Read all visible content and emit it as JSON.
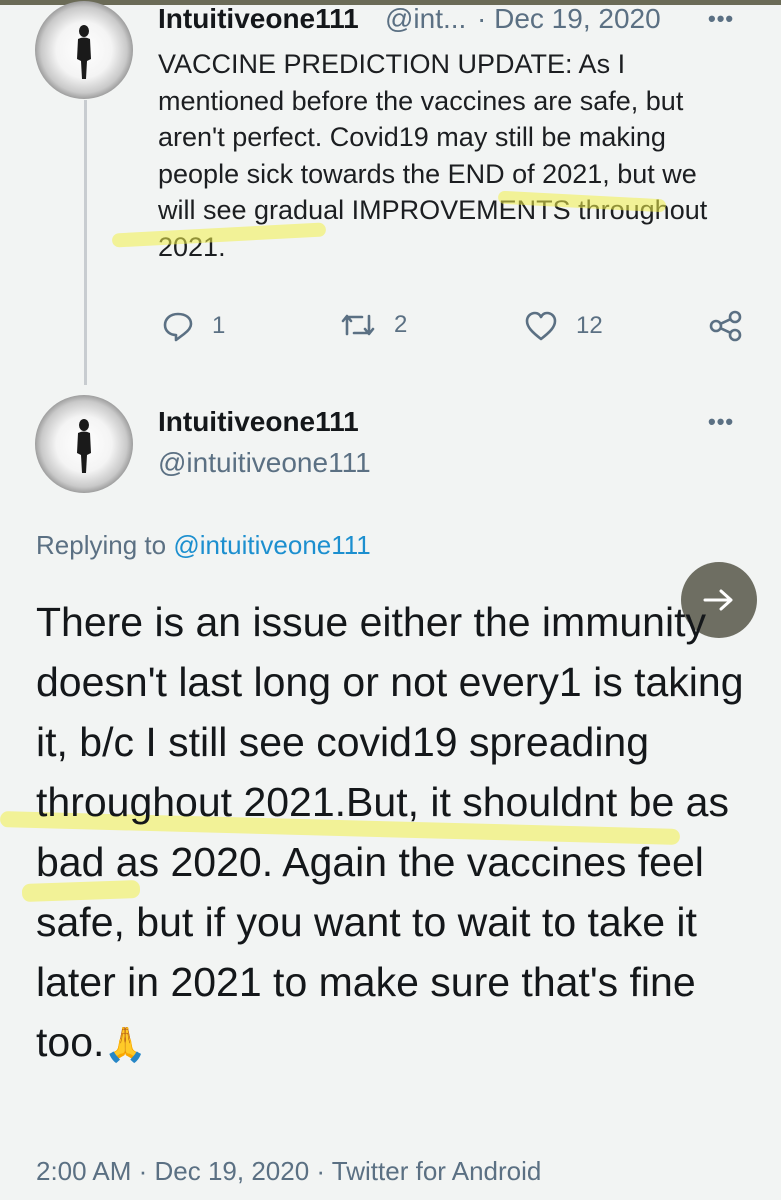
{
  "tweet1": {
    "display_name": "Intuitiveone111",
    "handle_truncated": "@int...",
    "separator_date": "· Dec 19, 2020",
    "more_label": "•••",
    "text": "VACCINE PREDICTION UPDATE: As I mentioned before the vaccines are safe, but aren't perfect. Covid19 may still be making people sick towards the END of 2021, but we will see gradual IMPROVEMENTS throughout 2021.",
    "replies": "1",
    "retweets": "2",
    "likes": "12"
  },
  "tweet2": {
    "display_name": "Intuitiveone111",
    "handle": "@intuitiveone111",
    "more_label": "•••",
    "replying_prefix": "Replying to ",
    "replying_handle": "@intuitiveone111",
    "text": "There is an issue either the immunity doesn't last long or not every1 is taking it, b/c I still see covid19 spreading throughout 2021.But, it shouldnt be as bad as 2020. Again the vaccines feel safe, but if you want to wait to take it later in 2021 to make sure that's fine too.",
    "emoji": "🙏",
    "timestamp": "2:00 AM · Dec 19, 2020 · Twitter for Android"
  },
  "icons": {
    "reply": "reply-icon",
    "retweet": "retweet-icon",
    "like": "heart-icon",
    "share": "share-icon",
    "next": "arrow-right-icon"
  },
  "colors": {
    "background": "#f2f4f3",
    "text": "#14171a",
    "muted": "#5b7083",
    "link": "#1c8fcf",
    "highlight": "#f3f04b",
    "arrow_button": "#6e6e62"
  }
}
